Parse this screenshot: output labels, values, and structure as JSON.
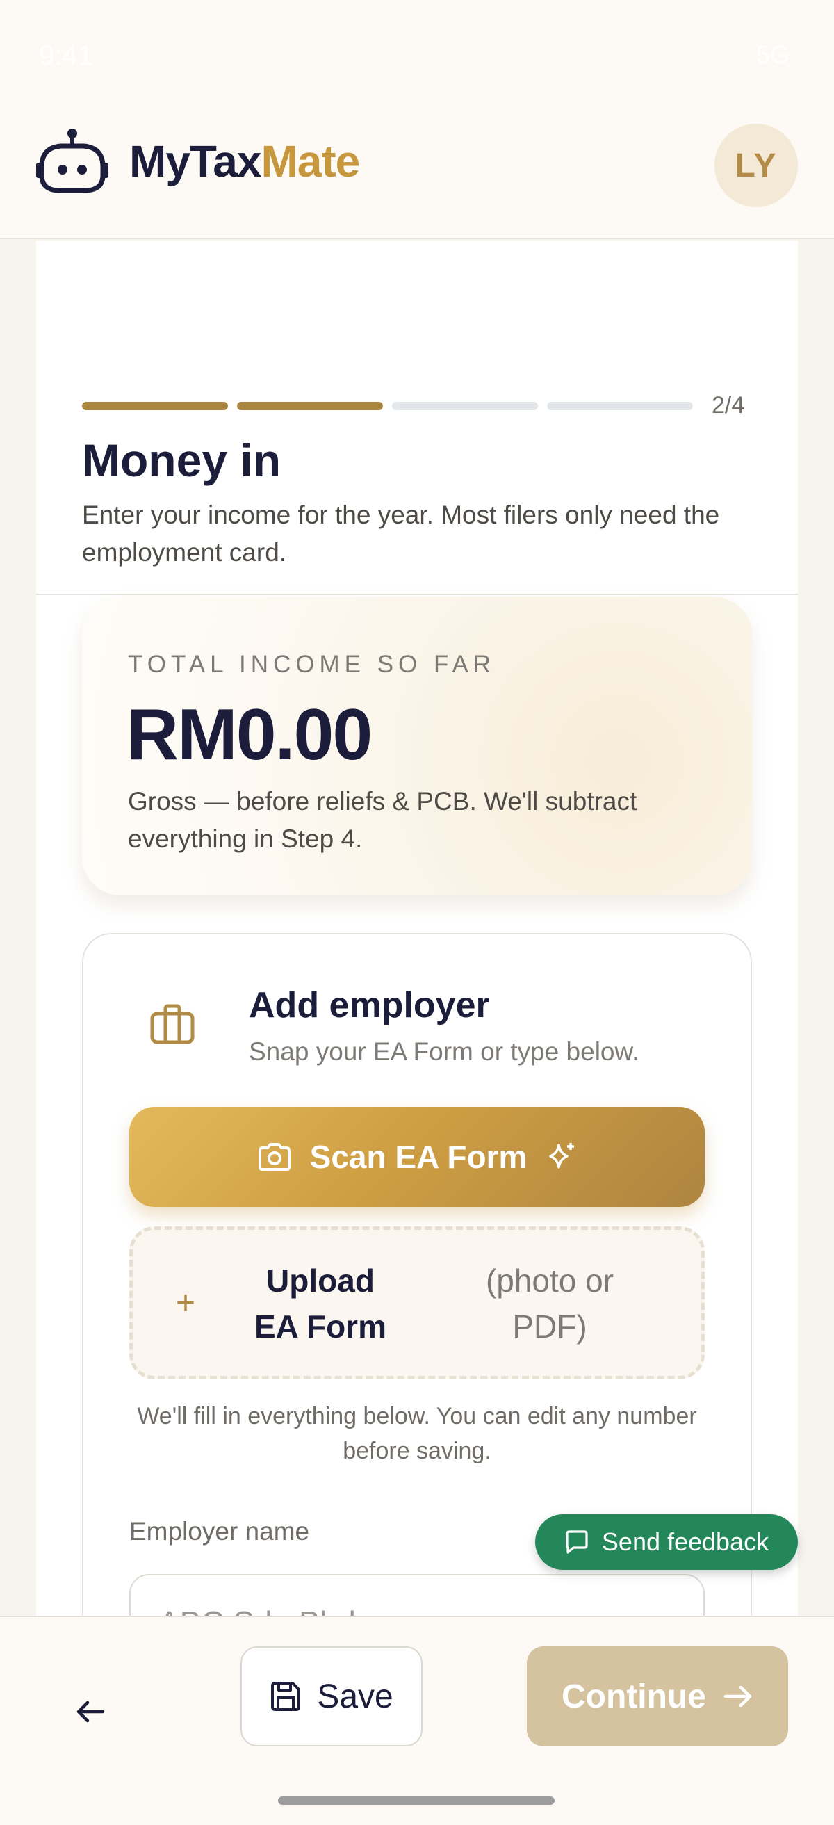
{
  "status_bar": {
    "time": "9:41",
    "system": "5G"
  },
  "app": {
    "brand_part1": "MyTax",
    "brand_part2": "Mate",
    "avatar_initials": "LY",
    "brand_color": "#c6973d"
  },
  "step": {
    "current": 2,
    "total": 4,
    "label": "2/4",
    "title": "Money in",
    "subtitle": "Enter your income for the year. Most filers only need the employment card."
  },
  "total_income": {
    "label": "TOTAL INCOME SO FAR",
    "value": "RM0.00",
    "note": "Gross — before reliefs & PCB. We'll subtract everything in Step 4."
  },
  "employer": {
    "icon": "briefcase-icon",
    "title": "Add employer",
    "subtitle": "Snap your EA Form or type below.",
    "scan_button": "Scan EA Form",
    "upload_main": "Upload EA Form",
    "upload_side": "(photo or PDF)",
    "hint": "We'll fill in everything below. You can edit any number before saving.",
    "name_label": "Employer name",
    "name_placeholder": "ABC Sdn Bhd"
  },
  "feedback_button": "Send feedback",
  "bottom": {
    "save_label": "Save",
    "continue_label": "Continue"
  },
  "colors": {
    "progress_done": "#a9853f",
    "progress_todo": "#e3e6eb",
    "feedback_green": "#23875a",
    "continue_disabled": "#d5c3a0"
  }
}
